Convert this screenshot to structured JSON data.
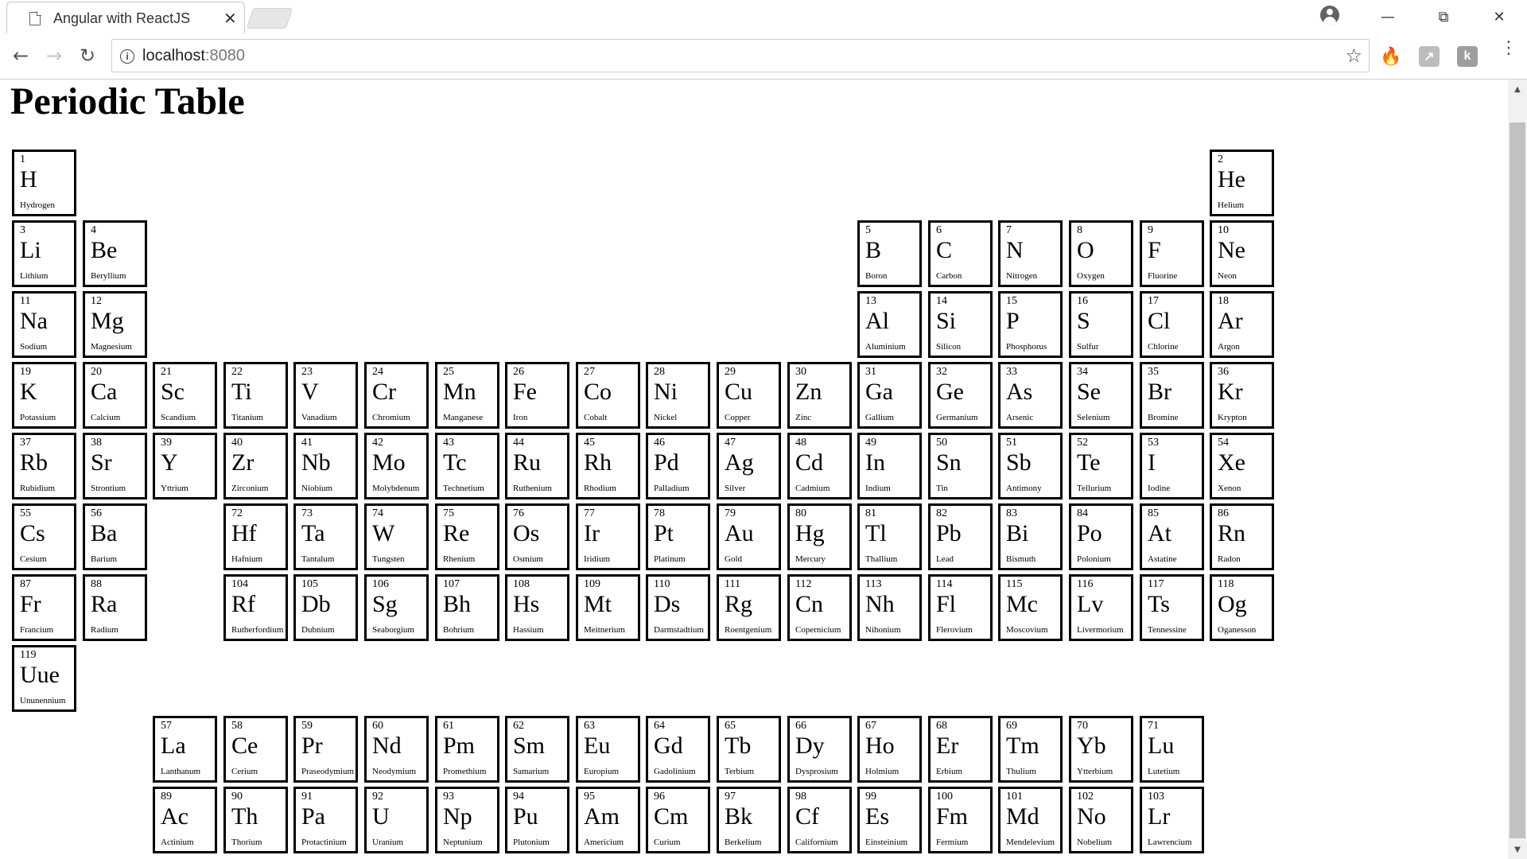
{
  "browser": {
    "tab_title": "Angular with ReactJS",
    "tab_close": "✕",
    "url_host": "localhost",
    "url_port": ":8080",
    "icons": {
      "back": "back-arrow-icon",
      "forward": "forward-arrow-icon",
      "reload": "reload-icon",
      "info": "info-icon",
      "star": "bookmark-star-icon",
      "menu": "menu-kebab-icon"
    }
  },
  "page": {
    "title": "Periodic Table"
  },
  "elements": [
    {
      "n": "1",
      "s": "H",
      "name": "Hydrogen",
      "row": 0,
      "col": 0
    },
    {
      "n": "2",
      "s": "He",
      "name": "Helium",
      "row": 0,
      "col": 17
    },
    {
      "n": "3",
      "s": "Li",
      "name": "Lithium",
      "row": 1,
      "col": 0
    },
    {
      "n": "4",
      "s": "Be",
      "name": "Beryllium",
      "row": 1,
      "col": 1
    },
    {
      "n": "5",
      "s": "B",
      "name": "Boron",
      "row": 1,
      "col": 12
    },
    {
      "n": "6",
      "s": "C",
      "name": "Carbon",
      "row": 1,
      "col": 13
    },
    {
      "n": "7",
      "s": "N",
      "name": "Nitrogen",
      "row": 1,
      "col": 14
    },
    {
      "n": "8",
      "s": "O",
      "name": "Oxygen",
      "row": 1,
      "col": 15
    },
    {
      "n": "9",
      "s": "F",
      "name": "Fluorine",
      "row": 1,
      "col": 16
    },
    {
      "n": "10",
      "s": "Ne",
      "name": "Neon",
      "row": 1,
      "col": 17
    },
    {
      "n": "11",
      "s": "Na",
      "name": "Sodium",
      "row": 2,
      "col": 0
    },
    {
      "n": "12",
      "s": "Mg",
      "name": "Magnesium",
      "row": 2,
      "col": 1
    },
    {
      "n": "13",
      "s": "Al",
      "name": "Aluminium",
      "row": 2,
      "col": 12
    },
    {
      "n": "14",
      "s": "Si",
      "name": "Silicon",
      "row": 2,
      "col": 13
    },
    {
      "n": "15",
      "s": "P",
      "name": "Phosphorus",
      "row": 2,
      "col": 14
    },
    {
      "n": "16",
      "s": "S",
      "name": "Sulfur",
      "row": 2,
      "col": 15
    },
    {
      "n": "17",
      "s": "Cl",
      "name": "Chlorine",
      "row": 2,
      "col": 16
    },
    {
      "n": "18",
      "s": "Ar",
      "name": "Argon",
      "row": 2,
      "col": 17
    },
    {
      "n": "19",
      "s": "K",
      "name": "Potassium",
      "row": 3,
      "col": 0
    },
    {
      "n": "20",
      "s": "Ca",
      "name": "Calcium",
      "row": 3,
      "col": 1
    },
    {
      "n": "21",
      "s": "Sc",
      "name": "Scandium",
      "row": 3,
      "col": 2
    },
    {
      "n": "22",
      "s": "Ti",
      "name": "Titanium",
      "row": 3,
      "col": 3
    },
    {
      "n": "23",
      "s": "V",
      "name": "Vanadium",
      "row": 3,
      "col": 4
    },
    {
      "n": "24",
      "s": "Cr",
      "name": "Chromium",
      "row": 3,
      "col": 5
    },
    {
      "n": "25",
      "s": "Mn",
      "name": "Manganese",
      "row": 3,
      "col": 6
    },
    {
      "n": "26",
      "s": "Fe",
      "name": "Iron",
      "row": 3,
      "col": 7
    },
    {
      "n": "27",
      "s": "Co",
      "name": "Cobalt",
      "row": 3,
      "col": 8
    },
    {
      "n": "28",
      "s": "Ni",
      "name": "Nickel",
      "row": 3,
      "col": 9
    },
    {
      "n": "29",
      "s": "Cu",
      "name": "Copper",
      "row": 3,
      "col": 10
    },
    {
      "n": "30",
      "s": "Zn",
      "name": "Zinc",
      "row": 3,
      "col": 11
    },
    {
      "n": "31",
      "s": "Ga",
      "name": "Gallium",
      "row": 3,
      "col": 12
    },
    {
      "n": "32",
      "s": "Ge",
      "name": "Germanium",
      "row": 3,
      "col": 13
    },
    {
      "n": "33",
      "s": "As",
      "name": "Arsenic",
      "row": 3,
      "col": 14
    },
    {
      "n": "34",
      "s": "Se",
      "name": "Selenium",
      "row": 3,
      "col": 15
    },
    {
      "n": "35",
      "s": "Br",
      "name": "Bromine",
      "row": 3,
      "col": 16
    },
    {
      "n": "36",
      "s": "Kr",
      "name": "Krypton",
      "row": 3,
      "col": 17
    },
    {
      "n": "37",
      "s": "Rb",
      "name": "Rubidium",
      "row": 4,
      "col": 0
    },
    {
      "n": "38",
      "s": "Sr",
      "name": "Strontium",
      "row": 4,
      "col": 1
    },
    {
      "n": "39",
      "s": "Y",
      "name": "Yttrium",
      "row": 4,
      "col": 2
    },
    {
      "n": "40",
      "s": "Zr",
      "name": "Zirconium",
      "row": 4,
      "col": 3
    },
    {
      "n": "41",
      "s": "Nb",
      "name": "Niobium",
      "row": 4,
      "col": 4
    },
    {
      "n": "42",
      "s": "Mo",
      "name": "Molybdenum",
      "row": 4,
      "col": 5
    },
    {
      "n": "43",
      "s": "Tc",
      "name": "Technetium",
      "row": 4,
      "col": 6
    },
    {
      "n": "44",
      "s": "Ru",
      "name": "Ruthenium",
      "row": 4,
      "col": 7
    },
    {
      "n": "45",
      "s": "Rh",
      "name": "Rhodium",
      "row": 4,
      "col": 8
    },
    {
      "n": "46",
      "s": "Pd",
      "name": "Palladium",
      "row": 4,
      "col": 9
    },
    {
      "n": "47",
      "s": "Ag",
      "name": "Silver",
      "row": 4,
      "col": 10
    },
    {
      "n": "48",
      "s": "Cd",
      "name": "Cadmium",
      "row": 4,
      "col": 11
    },
    {
      "n": "49",
      "s": "In",
      "name": "Indium",
      "row": 4,
      "col": 12
    },
    {
      "n": "50",
      "s": "Sn",
      "name": "Tin",
      "row": 4,
      "col": 13
    },
    {
      "n": "51",
      "s": "Sb",
      "name": "Antimony",
      "row": 4,
      "col": 14
    },
    {
      "n": "52",
      "s": "Te",
      "name": "Tellurium",
      "row": 4,
      "col": 15
    },
    {
      "n": "53",
      "s": "I",
      "name": "Iodine",
      "row": 4,
      "col": 16
    },
    {
      "n": "54",
      "s": "Xe",
      "name": "Xenon",
      "row": 4,
      "col": 17
    },
    {
      "n": "55",
      "s": "Cs",
      "name": "Cesium",
      "row": 5,
      "col": 0
    },
    {
      "n": "56",
      "s": "Ba",
      "name": "Barium",
      "row": 5,
      "col": 1
    },
    {
      "n": "72",
      "s": "Hf",
      "name": "Hafnium",
      "row": 5,
      "col": 3
    },
    {
      "n": "73",
      "s": "Ta",
      "name": "Tantalum",
      "row": 5,
      "col": 4
    },
    {
      "n": "74",
      "s": "W",
      "name": "Tungsten",
      "row": 5,
      "col": 5
    },
    {
      "n": "75",
      "s": "Re",
      "name": "Rhenium",
      "row": 5,
      "col": 6
    },
    {
      "n": "76",
      "s": "Os",
      "name": "Osmium",
      "row": 5,
      "col": 7
    },
    {
      "n": "77",
      "s": "Ir",
      "name": "Iridium",
      "row": 5,
      "col": 8
    },
    {
      "n": "78",
      "s": "Pt",
      "name": "Platinum",
      "row": 5,
      "col": 9
    },
    {
      "n": "79",
      "s": "Au",
      "name": "Gold",
      "row": 5,
      "col": 10
    },
    {
      "n": "80",
      "s": "Hg",
      "name": "Mercury",
      "row": 5,
      "col": 11
    },
    {
      "n": "81",
      "s": "Tl",
      "name": "Thallium",
      "row": 5,
      "col": 12
    },
    {
      "n": "82",
      "s": "Pb",
      "name": "Lead",
      "row": 5,
      "col": 13
    },
    {
      "n": "83",
      "s": "Bi",
      "name": "Bismuth",
      "row": 5,
      "col": 14
    },
    {
      "n": "84",
      "s": "Po",
      "name": "Polonium",
      "row": 5,
      "col": 15
    },
    {
      "n": "85",
      "s": "At",
      "name": "Astatine",
      "row": 5,
      "col": 16
    },
    {
      "n": "86",
      "s": "Rn",
      "name": "Radon",
      "row": 5,
      "col": 17
    },
    {
      "n": "87",
      "s": "Fr",
      "name": "Francium",
      "row": 6,
      "col": 0
    },
    {
      "n": "88",
      "s": "Ra",
      "name": "Radium",
      "row": 6,
      "col": 1
    },
    {
      "n": "104",
      "s": "Rf",
      "name": "Rutherfordium",
      "row": 6,
      "col": 3
    },
    {
      "n": "105",
      "s": "Db",
      "name": "Dubnium",
      "row": 6,
      "col": 4
    },
    {
      "n": "106",
      "s": "Sg",
      "name": "Seaborgium",
      "row": 6,
      "col": 5
    },
    {
      "n": "107",
      "s": "Bh",
      "name": "Bohrium",
      "row": 6,
      "col": 6
    },
    {
      "n": "108",
      "s": "Hs",
      "name": "Hassium",
      "row": 6,
      "col": 7
    },
    {
      "n": "109",
      "s": "Mt",
      "name": "Meitnerium",
      "row": 6,
      "col": 8
    },
    {
      "n": "110",
      "s": "Ds",
      "name": "Darmstadtium",
      "row": 6,
      "col": 9
    },
    {
      "n": "111",
      "s": "Rg",
      "name": "Roentgenium",
      "row": 6,
      "col": 10
    },
    {
      "n": "112",
      "s": "Cn",
      "name": "Copernicium",
      "row": 6,
      "col": 11
    },
    {
      "n": "113",
      "s": "Nh",
      "name": "Nihonium",
      "row": 6,
      "col": 12
    },
    {
      "n": "114",
      "s": "Fl",
      "name": "Flerovium",
      "row": 6,
      "col": 13
    },
    {
      "n": "115",
      "s": "Mc",
      "name": "Moscovium",
      "row": 6,
      "col": 14
    },
    {
      "n": "116",
      "s": "Lv",
      "name": "Livermorium",
      "row": 6,
      "col": 15
    },
    {
      "n": "117",
      "s": "Ts",
      "name": "Tennessine",
      "row": 6,
      "col": 16
    },
    {
      "n": "118",
      "s": "Og",
      "name": "Oganesson",
      "row": 6,
      "col": 17
    },
    {
      "n": "119",
      "s": "Uue",
      "name": "Ununennium",
      "row": 7,
      "col": 0
    },
    {
      "n": "57",
      "s": "La",
      "name": "Lanthanum",
      "row": 8,
      "col": 2
    },
    {
      "n": "58",
      "s": "Ce",
      "name": "Cerium",
      "row": 8,
      "col": 3
    },
    {
      "n": "59",
      "s": "Pr",
      "name": "Praseodymium",
      "row": 8,
      "col": 4
    },
    {
      "n": "60",
      "s": "Nd",
      "name": "Neodymium",
      "row": 8,
      "col": 5
    },
    {
      "n": "61",
      "s": "Pm",
      "name": "Promethium",
      "row": 8,
      "col": 6
    },
    {
      "n": "62",
      "s": "Sm",
      "name": "Samarium",
      "row": 8,
      "col": 7
    },
    {
      "n": "63",
      "s": "Eu",
      "name": "Europium",
      "row": 8,
      "col": 8
    },
    {
      "n": "64",
      "s": "Gd",
      "name": "Gadolinium",
      "row": 8,
      "col": 9
    },
    {
      "n": "65",
      "s": "Tb",
      "name": "Terbium",
      "row": 8,
      "col": 10
    },
    {
      "n": "66",
      "s": "Dy",
      "name": "Dysprosium",
      "row": 8,
      "col": 11
    },
    {
      "n": "67",
      "s": "Ho",
      "name": "Holmium",
      "row": 8,
      "col": 12
    },
    {
      "n": "68",
      "s": "Er",
      "name": "Erbium",
      "row": 8,
      "col": 13
    },
    {
      "n": "69",
      "s": "Tm",
      "name": "Thulium",
      "row": 8,
      "col": 14
    },
    {
      "n": "70",
      "s": "Yb",
      "name": "Ytterbium",
      "row": 8,
      "col": 15
    },
    {
      "n": "71",
      "s": "Lu",
      "name": "Lutetium",
      "row": 8,
      "col": 16
    },
    {
      "n": "89",
      "s": "Ac",
      "name": "Actinium",
      "row": 9,
      "col": 2
    },
    {
      "n": "90",
      "s": "Th",
      "name": "Thorium",
      "row": 9,
      "col": 3
    },
    {
      "n": "91",
      "s": "Pa",
      "name": "Protactinium",
      "row": 9,
      "col": 4
    },
    {
      "n": "92",
      "s": "U",
      "name": "Uranium",
      "row": 9,
      "col": 5
    },
    {
      "n": "93",
      "s": "Np",
      "name": "Neptunium",
      "row": 9,
      "col": 6
    },
    {
      "n": "94",
      "s": "Pu",
      "name": "Plutonium",
      "row": 9,
      "col": 7
    },
    {
      "n": "95",
      "s": "Am",
      "name": "Americium",
      "row": 9,
      "col": 8
    },
    {
      "n": "96",
      "s": "Cm",
      "name": "Curium",
      "row": 9,
      "col": 9
    },
    {
      "n": "97",
      "s": "Bk",
      "name": "Berkelium",
      "row": 9,
      "col": 10
    },
    {
      "n": "98",
      "s": "Cf",
      "name": "Californium",
      "row": 9,
      "col": 11
    },
    {
      "n": "99",
      "s": "Es",
      "name": "Einsteinium",
      "row": 9,
      "col": 12
    },
    {
      "n": "100",
      "s": "Fm",
      "name": "Fermium",
      "row": 9,
      "col": 13
    },
    {
      "n": "101",
      "s": "Md",
      "name": "Mendelevium",
      "row": 9,
      "col": 14
    },
    {
      "n": "102",
      "s": "No",
      "name": "Nobelium",
      "row": 9,
      "col": 15
    },
    {
      "n": "103",
      "s": "Lr",
      "name": "Lawrencium",
      "row": 9,
      "col": 16
    }
  ]
}
